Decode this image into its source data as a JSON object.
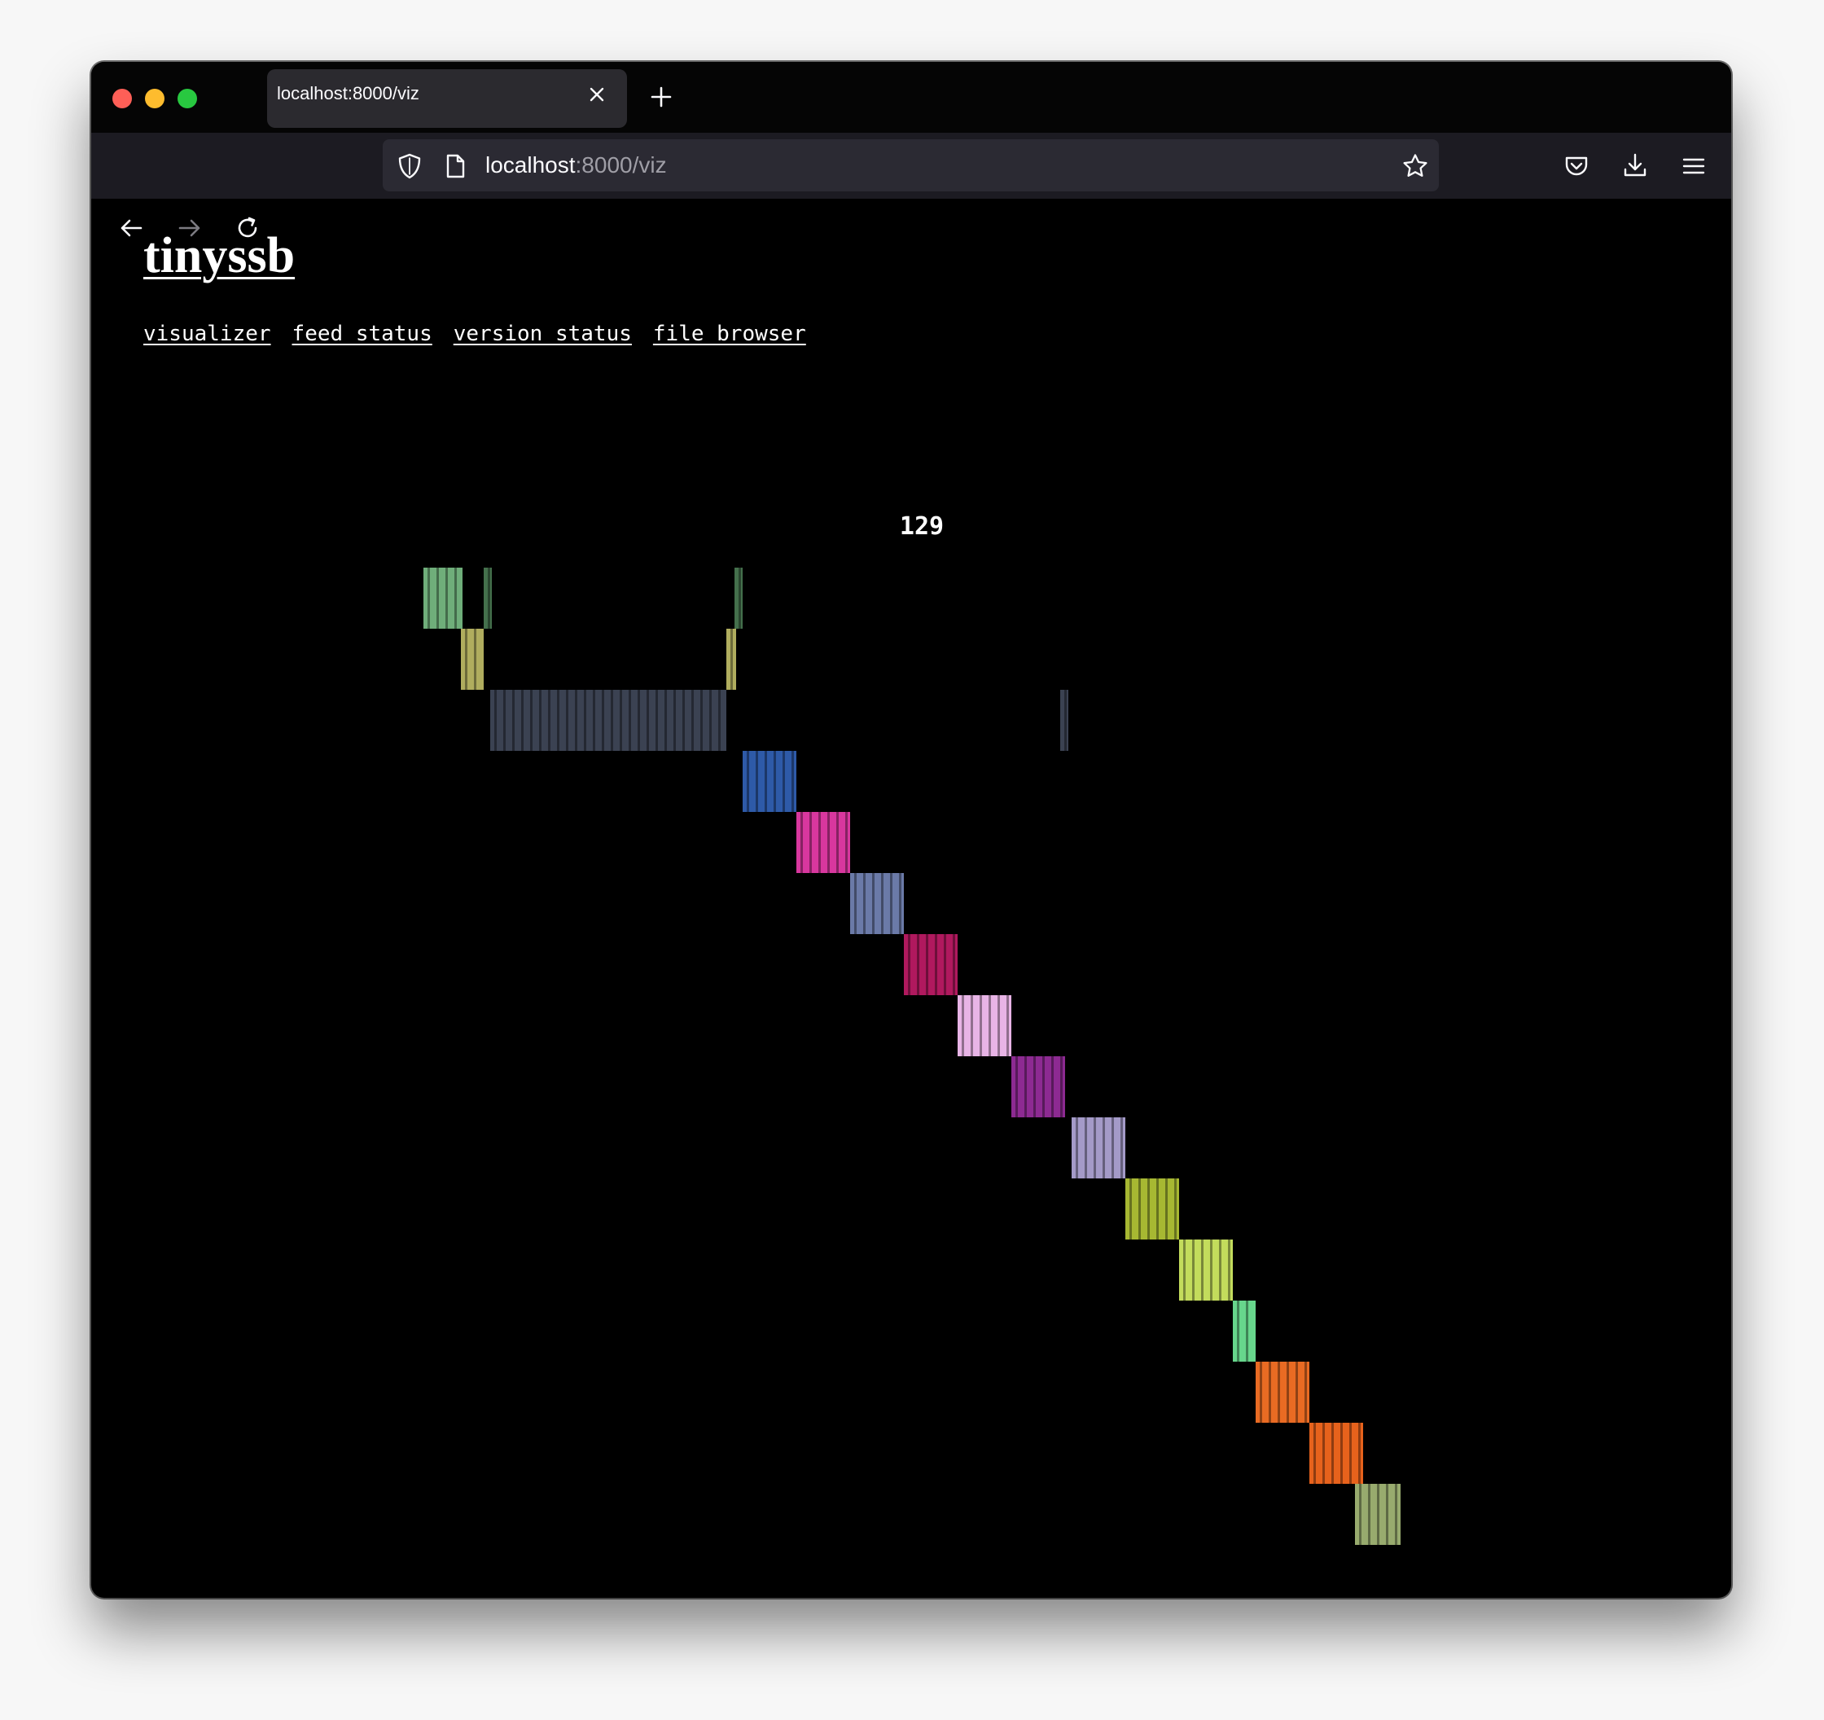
{
  "browser": {
    "tab_title": "localhost:8000/viz",
    "url_host": "localhost",
    "url_path": ":8000/viz",
    "icons": {
      "close_tab": "close-icon",
      "new_tab": "plus-icon",
      "back": "arrow-left-icon",
      "forward": "arrow-right-icon",
      "reload": "reload-icon",
      "tracking": "shield-icon",
      "page": "page-icon",
      "bookmark": "star-icon",
      "pocket": "pocket-icon",
      "downloads": "download-icon",
      "menu": "hamburger-menu-icon"
    }
  },
  "page": {
    "title": "tinyssb",
    "nav": [
      "visualizer",
      "feed_status",
      "version_status",
      "file_browser"
    ],
    "counter": "129"
  },
  "colors": {
    "page_bg": "#000000",
    "link": "#ffffff"
  },
  "visualizer": {
    "description_colors": [
      "#6fae7a",
      "#44704c",
      "#b0ad5e",
      "#3b4252",
      "#2e5aa8",
      "#d8379e",
      "#6b7aa8",
      "#b0195e",
      "#e8b4e6",
      "#8d2a92",
      "#a49ac8",
      "#a7b832",
      "#c3dc5c",
      "#67d68c",
      "#e96b23",
      "#e7621c",
      "#98ab6e"
    ]
  }
}
